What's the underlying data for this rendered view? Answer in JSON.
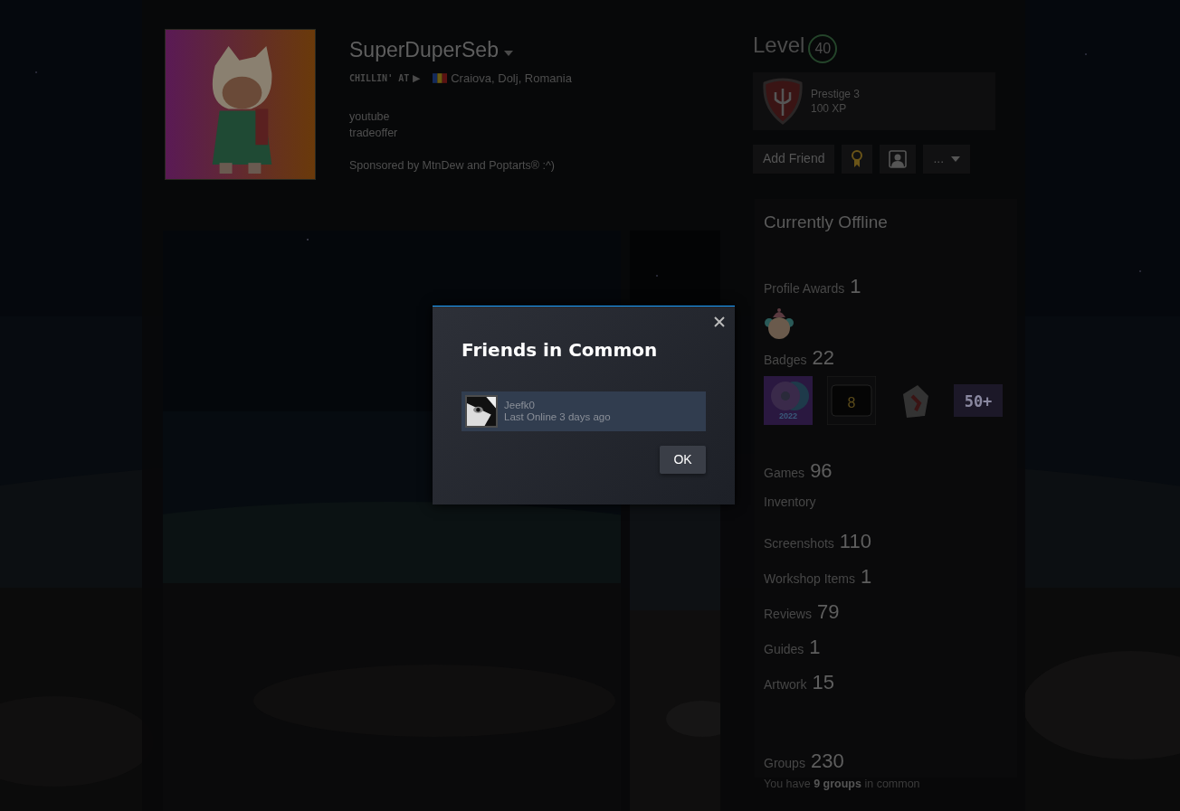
{
  "profile": {
    "name": "SuperDuperSeb",
    "status_label": "CHILLIN' AT",
    "play_glyph": "▶",
    "location": "Craiova, Dolj, Romania",
    "summary": [
      "youtube",
      "tradeoffer",
      "Sponsored by MtnDew and Poptarts® :^)"
    ]
  },
  "level": {
    "label": "Level",
    "value": "40"
  },
  "favorite_badge": {
    "name": "Prestige 3",
    "xp": "100 XP"
  },
  "actions": {
    "add_friend": "Add Friend",
    "more": "..."
  },
  "online_status": "Currently Offline",
  "awards": {
    "label": "Profile Awards",
    "count": "1"
  },
  "badges": {
    "label": "Badges",
    "count": "22",
    "items": [
      {
        "kind": "steam",
        "text": "2022"
      },
      {
        "kind": "eight",
        "text": "8"
      },
      {
        "kind": "letter"
      },
      {
        "kind": "pixel",
        "text": "50+"
      }
    ]
  },
  "links": [
    {
      "label": "Games",
      "count": "96"
    },
    {
      "label": "Inventory"
    },
    {
      "label": "Screenshots",
      "count": "110"
    },
    {
      "label": "Workshop Items",
      "count": "1"
    },
    {
      "label": "Reviews",
      "count": "79"
    },
    {
      "label": "Guides",
      "count": "1"
    },
    {
      "label": "Artwork",
      "count": "15"
    }
  ],
  "groups": {
    "label": "Groups",
    "count": "230",
    "common": "You have **9 groups** in common"
  },
  "dialog": {
    "title": "Friends in Common",
    "friends": [
      {
        "name": "Jeefk0",
        "last_online": "Last Online 3 days ago"
      }
    ],
    "ok": "OK"
  }
}
